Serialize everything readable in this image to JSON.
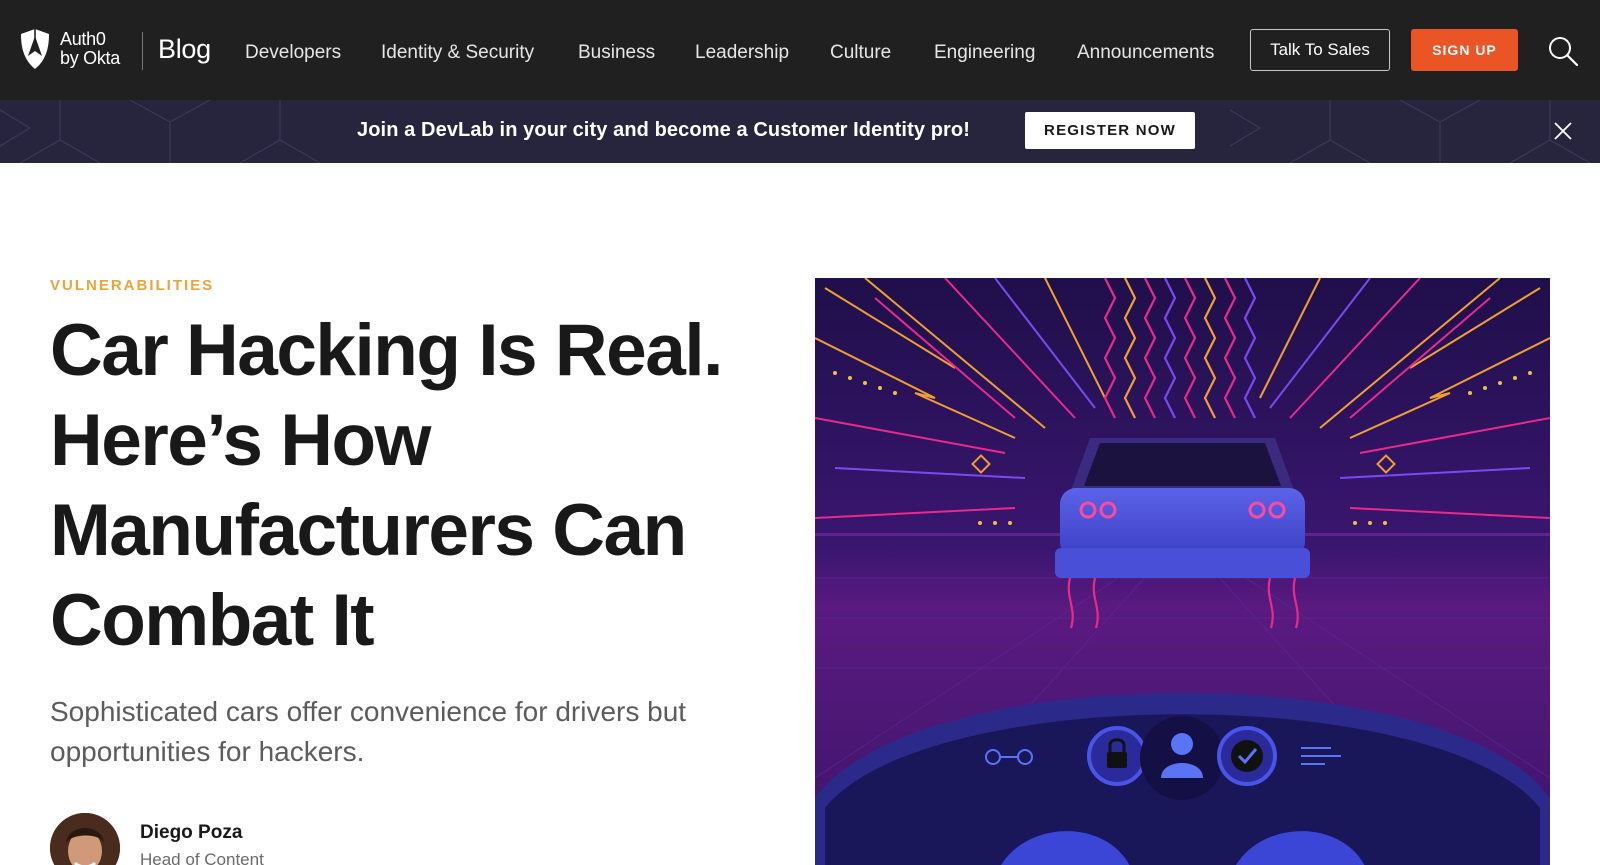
{
  "brand": {
    "logo_line1": "Auth0",
    "logo_line2": "by Okta",
    "blog_label": "Blog"
  },
  "nav": {
    "links": [
      "Developers",
      "Identity & Security",
      "Business",
      "Leadership",
      "Culture",
      "Engineering",
      "Announcements"
    ],
    "talk_to_sales": "Talk To Sales",
    "sign_up": "SIGN UP",
    "search_icon": "search-icon"
  },
  "banner": {
    "text": "Join a DevLab in your city and become a Customer Identity pro!",
    "button": "REGISTER NOW",
    "close_icon": "close-icon"
  },
  "article": {
    "category": "VULNERABILITIES",
    "title": "Car Hacking Is Real. Here’s How Manufacturers Can Combat It",
    "subtitle": "Sophisticated cars offer convenience for drivers but opportunities for hackers.",
    "author_name": "Diego Poza",
    "author_role": "Head of Content"
  },
  "colors": {
    "nav_bg": "#202020",
    "banner_bg": "#26253d",
    "accent_orange": "#eb5424",
    "category_color": "#eba43a",
    "hero_bg": "#2a1458"
  }
}
